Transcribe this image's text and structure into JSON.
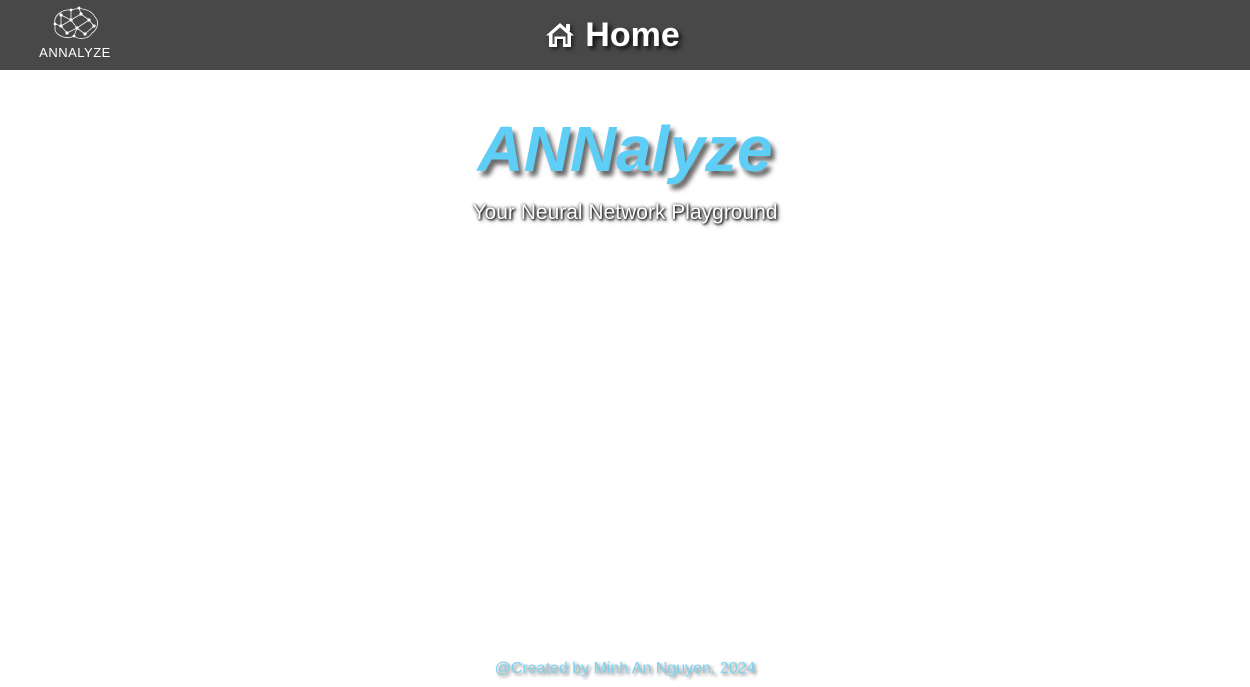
{
  "header": {
    "logo_text": "ANNALYZE",
    "title": "Home",
    "title_icon": "home-icon"
  },
  "hero": {
    "title": "ANNalyze",
    "subtitle": "Your Neural Network Playground"
  },
  "footer": {
    "credit": "@Created by Minh An Nguyen, 2024"
  },
  "colors": {
    "header_bg": "#484848",
    "hero_title": "#5ecef6",
    "footer_text": "#7fd3f0",
    "page_bg": "#ffffff"
  }
}
